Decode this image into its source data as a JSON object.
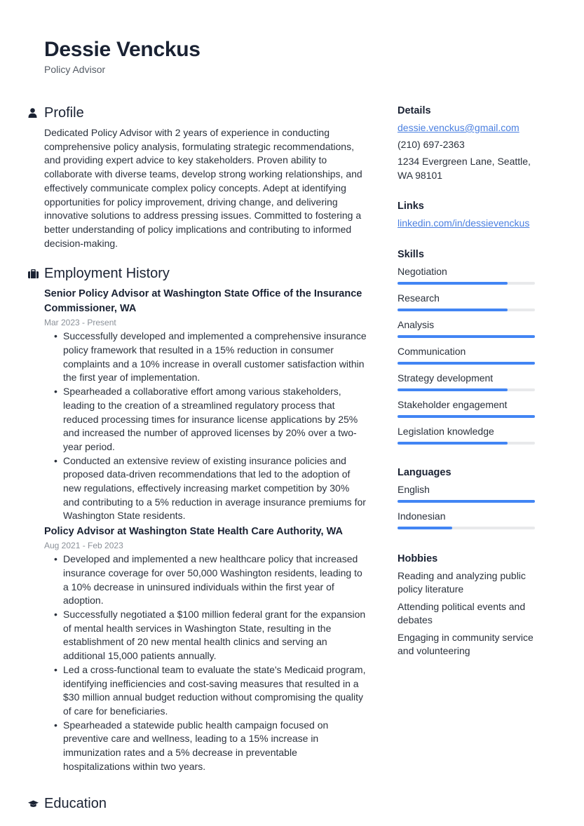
{
  "header": {
    "name": "Dessie Venckus",
    "title": "Policy Advisor"
  },
  "profile": {
    "heading": "Profile",
    "icon": "person-icon",
    "text": "Dedicated Policy Advisor with 2 years of experience in conducting comprehensive policy analysis, formulating strategic recommendations, and providing expert advice to key stakeholders. Proven ability to collaborate with diverse teams, develop strong working relationships, and effectively communicate complex policy concepts. Adept at identifying opportunities for policy improvement, driving change, and delivering innovative solutions to address pressing issues. Committed to fostering a better understanding of policy implications and contributing to informed decision-making."
  },
  "employment": {
    "heading": "Employment History",
    "icon": "briefcase-icon",
    "jobs": [
      {
        "title": "Senior Policy Advisor at Washington State Office of the Insurance Commissioner, WA",
        "dates": "Mar 2023 - Present",
        "bullets": [
          "Successfully developed and implemented a comprehensive insurance policy framework that resulted in a 15% reduction in consumer complaints and a 10% increase in overall customer satisfaction within the first year of implementation.",
          "Spearheaded a collaborative effort among various stakeholders, leading to the creation of a streamlined regulatory process that reduced processing times for insurance license applications by 25% and increased the number of approved licenses by 20% over a two-year period.",
          "Conducted an extensive review of existing insurance policies and proposed data-driven recommendations that led to the adoption of new regulations, effectively increasing market competition by 30% and contributing to a 5% reduction in average insurance premiums for Washington State residents."
        ]
      },
      {
        "title": "Policy Advisor at Washington State Health Care Authority, WA",
        "dates": "Aug 2021 - Feb 2023",
        "bullets": [
          "Developed and implemented a new healthcare policy that increased insurance coverage for over 50,000 Washington residents, leading to a 10% decrease in uninsured individuals within the first year of adoption.",
          "Successfully negotiated a $100 million federal grant for the expansion of mental health services in Washington State, resulting in the establishment of 20 new mental health clinics and serving an additional 15,000 patients annually.",
          "Led a cross-functional team to evaluate the state's Medicaid program, identifying inefficiencies and cost-saving measures that resulted in a $30 million annual budget reduction without compromising the quality of care for beneficiaries.",
          "Spearheaded a statewide public health campaign focused on preventive care and wellness, leading to a 15% increase in immunization rates and a 5% decrease in preventable hospitalizations within two years."
        ]
      }
    ]
  },
  "education": {
    "heading": "Education",
    "icon": "graduation-cap-icon"
  },
  "details": {
    "heading": "Details",
    "email": "dessie.venckus@gmail.com",
    "phone": "(210) 697-2363",
    "address": "1234 Evergreen Lane, Seattle, WA 98101"
  },
  "links": {
    "heading": "Links",
    "items": [
      "linkedin.com/in/dessievenckus"
    ]
  },
  "skills": {
    "heading": "Skills",
    "items": [
      {
        "label": "Negotiation",
        "level": 0.8
      },
      {
        "label": "Research",
        "level": 0.8
      },
      {
        "label": "Analysis",
        "level": 1.0
      },
      {
        "label": "Communication",
        "level": 1.0
      },
      {
        "label": "Strategy development",
        "level": 0.8
      },
      {
        "label": "Stakeholder engagement",
        "level": 1.0
      },
      {
        "label": "Legislation knowledge",
        "level": 0.8
      }
    ]
  },
  "languages": {
    "heading": "Languages",
    "items": [
      {
        "label": "English",
        "level": 1.0
      },
      {
        "label": "Indonesian",
        "level": 0.4
      }
    ]
  },
  "hobbies": {
    "heading": "Hobbies",
    "items": [
      "Reading and analyzing public policy literature",
      "Attending political events and debates",
      "Engaging in community service and volunteering"
    ]
  },
  "colors": {
    "accent": "#4285f4",
    "bar_track": "#e8e9eb",
    "link": "#4a7fe0",
    "heading": "#1a2233"
  }
}
